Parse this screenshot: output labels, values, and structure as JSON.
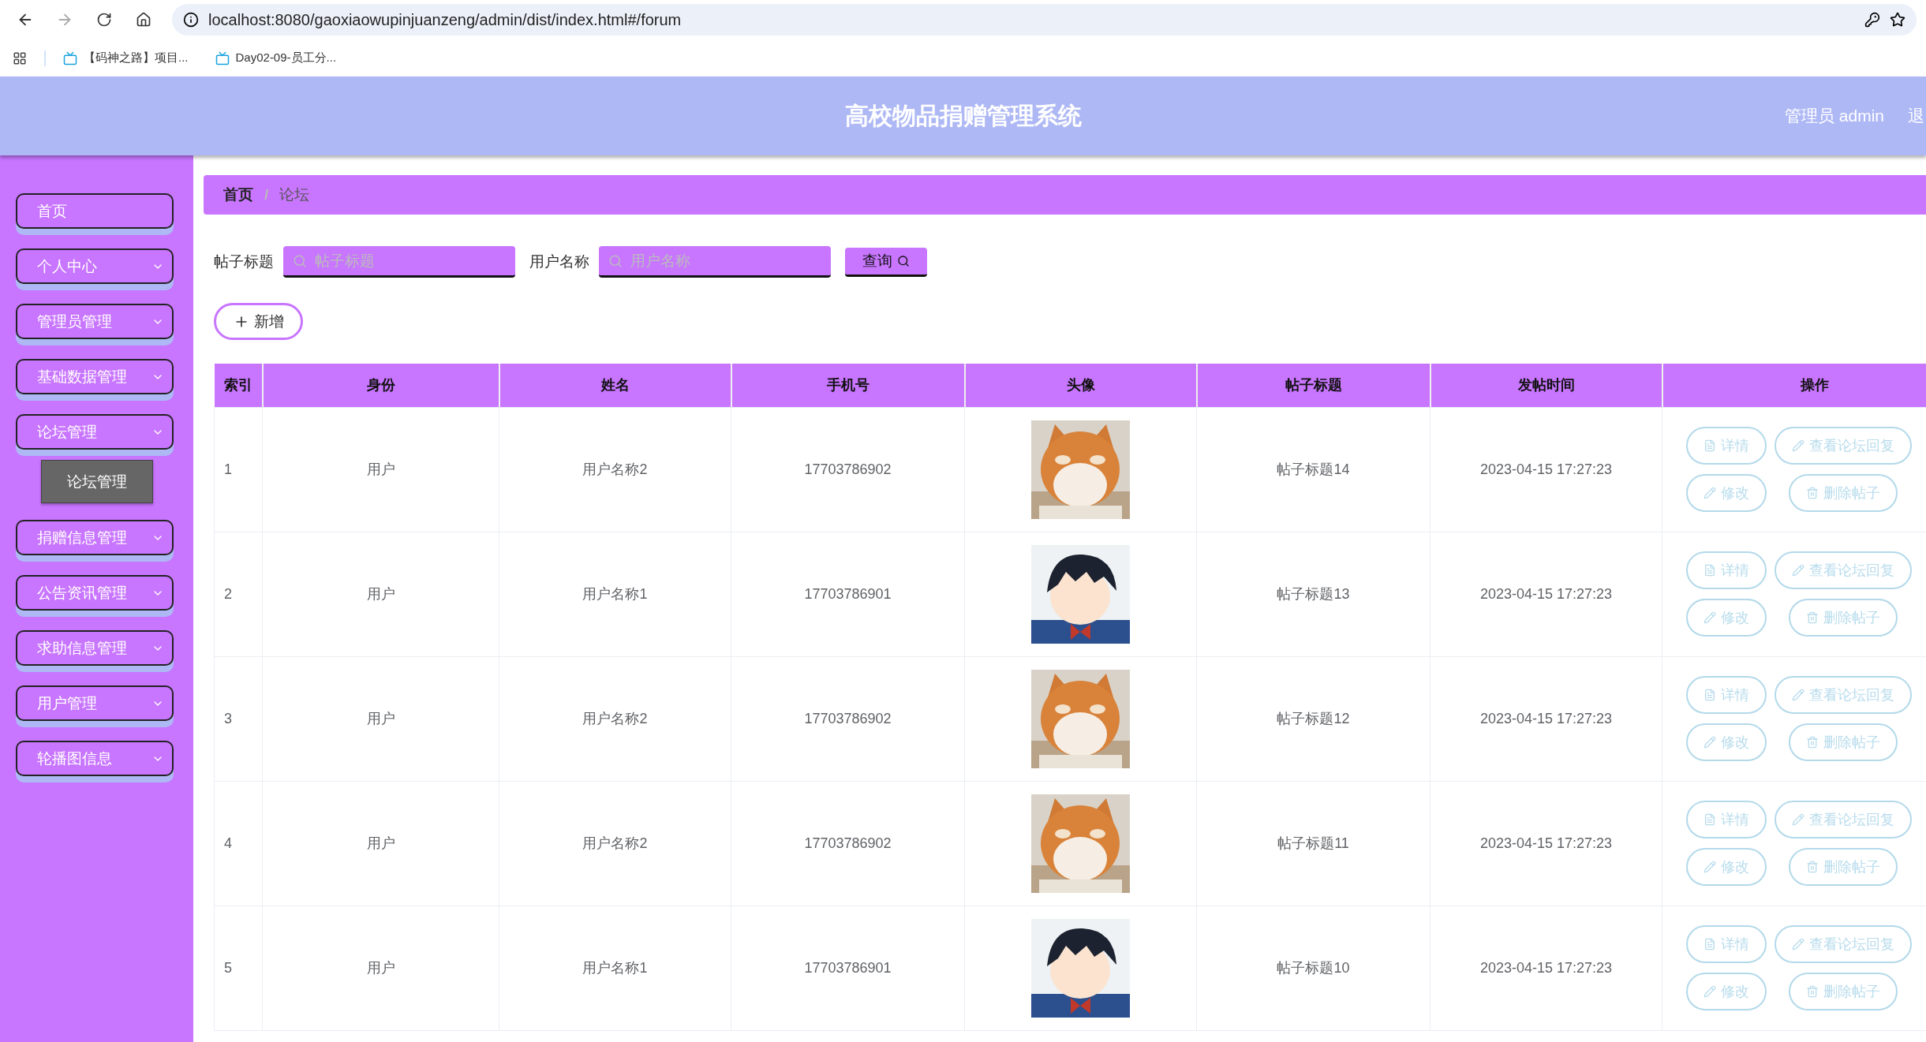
{
  "browser": {
    "url": "localhost:8080/gaoxiaowupinjuanzeng/admin/dist/index.html#/forum",
    "back_disabled": false,
    "forward_disabled": true,
    "bookmarks": [
      {
        "label": "【码神之路】项目..."
      },
      {
        "label": "Day02-09-员工分..."
      }
    ]
  },
  "header": {
    "title": "高校物品捐赠管理系统",
    "user": "管理员 admin",
    "logout": "退"
  },
  "sidebar": {
    "items": [
      {
        "label": "首页",
        "kind": "link"
      },
      {
        "label": "个人中心",
        "kind": "menu"
      },
      {
        "label": "管理员管理",
        "kind": "menu"
      },
      {
        "label": "基础数据管理",
        "kind": "menu"
      },
      {
        "label": "论坛管理",
        "kind": "menu",
        "children": [
          {
            "label": "论坛管理",
            "selected": true
          }
        ]
      },
      {
        "label": "捐赠信息管理",
        "kind": "menu"
      },
      {
        "label": "公告资讯管理",
        "kind": "menu"
      },
      {
        "label": "求助信息管理",
        "kind": "menu"
      },
      {
        "label": "用户管理",
        "kind": "menu"
      },
      {
        "label": "轮播图信息",
        "kind": "menu"
      }
    ]
  },
  "breadcrumb": {
    "separator": "/",
    "items": [
      {
        "label": "首页",
        "current": false
      },
      {
        "label": "论坛",
        "current": true
      }
    ]
  },
  "search": {
    "fields": [
      {
        "label": "帖子标题",
        "placeholder": "帖子标题"
      },
      {
        "label": "用户名称",
        "placeholder": "用户名称"
      }
    ],
    "query_button": "查询"
  },
  "add_button": "新增",
  "table": {
    "columns": [
      "索引",
      "身份",
      "姓名",
      "手机号",
      "头像",
      "帖子标题",
      "发帖时间",
      "操作"
    ],
    "rows": [
      {
        "index": "1",
        "role": "用户",
        "name": "用户名称2",
        "phone": "17703786902",
        "avatar": {
          "kind": "picture"
        },
        "title": "帖子标题14",
        "time": "2023-04-15 17:27:23",
        "actions": [
          {
            "label": "详情",
            "kind": "detail"
          },
          {
            "label": "查看论坛回复",
            "kind": "replies"
          },
          {
            "label": "修改",
            "kind": "edit"
          },
          {
            "label": "删除帖子",
            "kind": "delete"
          }
        ]
      },
      {
        "index": "2",
        "role": "用户",
        "name": "用户名称1",
        "phone": "17703786901",
        "avatar": {
          "kind": "picture"
        },
        "title": "帖子标题13",
        "time": "2023-04-15 17:27:23",
        "actions": [
          {
            "label": "详情",
            "kind": "detail"
          },
          {
            "label": "查看论坛回复",
            "kind": "replies"
          },
          {
            "label": "修改",
            "kind": "edit"
          },
          {
            "label": "删除帖子",
            "kind": "delete"
          }
        ]
      },
      {
        "index": "3",
        "role": "用户",
        "name": "用户名称2",
        "phone": "17703786902",
        "avatar": {
          "kind": "picture"
        },
        "title": "帖子标题12",
        "time": "2023-04-15 17:27:23",
        "actions": [
          {
            "label": "详情",
            "kind": "detail"
          },
          {
            "label": "查看论坛回复",
            "kind": "replies"
          },
          {
            "label": "修改",
            "kind": "edit"
          },
          {
            "label": "删除帖子",
            "kind": "delete"
          }
        ]
      },
      {
        "index": "4",
        "role": "用户",
        "name": "用户名称2",
        "phone": "17703786902",
        "avatar": {
          "kind": "picture"
        },
        "title": "帖子标题11",
        "time": "2023-04-15 17:27:23",
        "actions": [
          {
            "label": "详情",
            "kind": "detail"
          },
          {
            "label": "查看论坛回复",
            "kind": "replies"
          },
          {
            "label": "修改",
            "kind": "edit"
          },
          {
            "label": "删除帖子",
            "kind": "delete"
          }
        ]
      },
      {
        "index": "5",
        "role": "用户",
        "name": "用户名称1",
        "phone": "17703786901",
        "avatar": {
          "kind": "picture"
        },
        "title": "帖子标题10",
        "time": "2023-04-15 17:27:23",
        "actions": [
          {
            "label": "详情",
            "kind": "detail"
          },
          {
            "label": "查看论坛回复",
            "kind": "replies"
          },
          {
            "label": "修改",
            "kind": "edit"
          },
          {
            "label": "删除帖子",
            "kind": "delete"
          }
        ]
      }
    ]
  }
}
